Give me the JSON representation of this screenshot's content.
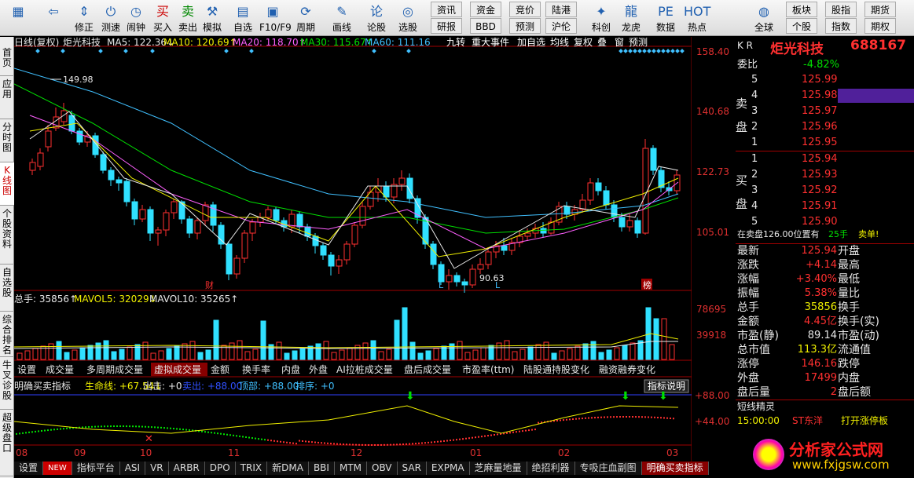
{
  "toolbar": {
    "buttons": [
      {
        "label": "",
        "icon": "grid-icon"
      },
      {
        "label": "",
        "icon": "back-arrow-icon"
      },
      {
        "label": "修正",
        "icon": "up-down-icon"
      },
      {
        "label": "测速",
        "icon": "power-icon"
      },
      {
        "label": "闹钟",
        "icon": "clock-icon"
      },
      {
        "label": "买入",
        "icon": "buy-icon"
      },
      {
        "label": "卖出",
        "icon": "sell-icon"
      },
      {
        "label": "模拟",
        "icon": "hammer-icon"
      },
      {
        "label": "自选",
        "icon": "select-icon"
      },
      {
        "label": "F10/F9",
        "icon": "f10-icon"
      },
      {
        "label": "周期",
        "icon": "period-icon"
      },
      {
        "label": "画线",
        "icon": "pencil-icon"
      },
      {
        "label": "论股",
        "icon": "discuss-icon"
      },
      {
        "label": "选股",
        "icon": "stock-select-icon"
      },
      {
        "label": "科创",
        "icon": "star-icon"
      },
      {
        "label": "龙虎",
        "icon": "dragon-icon"
      },
      {
        "label": "数据",
        "icon": "pe-icon"
      },
      {
        "label": "热点",
        "icon": "hot-icon"
      },
      {
        "label": "全球",
        "icon": "globe-icon"
      }
    ],
    "small": [
      "资讯",
      "资金",
      "竞价",
      "陆港",
      "研报",
      "BBD",
      "预测",
      "沪伦",
      "板块",
      "股指",
      "期货",
      "个股",
      "指数",
      "期权"
    ]
  },
  "left_tabs": [
    "首页",
    "应用",
    "分时图",
    "K线图",
    "个股资料",
    "自选股",
    "综合排名",
    "牛叉诊股",
    "超级盘口"
  ],
  "chart": {
    "header": {
      "period": "日线(复权)",
      "name": "炬光科技",
      "ma5": "MA5: 122.36↓",
      "ma10": "MA10: 120.69↑",
      "ma20": "MA20: 118.70↑",
      "ma30": "MA30: 115.67↑",
      "ma60": "MA60: 111.16"
    },
    "top_tabs": [
      "九转",
      "重大事件",
      "加自选",
      "均线",
      "复权",
      "叠",
      "窗",
      "预测"
    ],
    "price_scale": [
      "158.40",
      "140.68",
      "122.73",
      "105.01"
    ],
    "high_label": "149.98",
    "low_label": "90.63",
    "markers": [
      "财",
      "L",
      "L",
      "榜"
    ],
    "vol_header": {
      "total": "总手: 35856↑",
      "mavol5": "MAVOL5: 32029↓",
      "mavol10": "MAVOL10: 35265↑"
    },
    "vol_scale": [
      "78695",
      "39918"
    ],
    "mid_tabs": [
      "设置",
      "成交量",
      "多周期成交量",
      "虚拟成交量",
      "金额",
      "换手率",
      "内盘",
      "外盘",
      "AI拉桩成交量",
      "盘后成交量",
      "市盈率(ttm)",
      "陆股通持股变化",
      "融资融券变化"
    ],
    "ind_header": {
      "name": "明确买卖指标",
      "life": "生命线: +67.54↓",
      "out": "出击: +0",
      "sell": "卖出: +88.00",
      "top": "顶部: +88.00",
      "order": "排序: +0"
    },
    "ind_btn": "指标说明",
    "ind_scale": [
      "+88.00",
      "+44.00"
    ],
    "x_ticks": [
      "08",
      "09",
      "10",
      "11",
      "12",
      "01",
      "02",
      "03"
    ],
    "bottom_tabs": [
      "设置",
      "NEW",
      "指标平台",
      "ASI",
      "VR",
      "ARBR",
      "DPO",
      "TRIX",
      "新DMA",
      "BBI",
      "MTM",
      "OBV",
      "SAR",
      "EXPMA",
      "芝麻量地量",
      "绝招利器",
      "专吸庄血副图",
      "明确买卖指标"
    ]
  },
  "quote": {
    "market": "K R",
    "name": "炬光科技",
    "code": "688167",
    "weibi_label": "委比",
    "weibi": "-4.82%",
    "sell_label": "卖盘",
    "buy_label": "买盘",
    "sells": [
      {
        "n": "5",
        "p": "125.99",
        "v": ""
      },
      {
        "n": "4",
        "p": "125.98",
        "v": ""
      },
      {
        "n": "3",
        "p": "125.97",
        "v": ""
      },
      {
        "n": "2",
        "p": "125.96",
        "v": ""
      },
      {
        "n": "1",
        "p": "125.95",
        "v": ""
      }
    ],
    "buys": [
      {
        "n": "1",
        "p": "125.94",
        "v": ""
      },
      {
        "n": "2",
        "p": "125.93",
        "v": ""
      },
      {
        "n": "3",
        "p": "125.92",
        "v": ""
      },
      {
        "n": "4",
        "p": "125.91",
        "v": ""
      },
      {
        "n": "5",
        "p": "125.90",
        "v": ""
      }
    ],
    "position_line": "在卖盘126.00位置有",
    "position_hands": "25手",
    "position_tag": "卖单!",
    "stats": [
      {
        "l": "最新",
        "v": "125.94",
        "r": "开盘"
      },
      {
        "l": "涨跌",
        "v": "+4.14",
        "r": "最高"
      },
      {
        "l": "涨幅",
        "v": "+3.40%",
        "r": "最低"
      },
      {
        "l": "振幅",
        "v": "5.38%",
        "r": "量比"
      },
      {
        "l": "总手",
        "v": "35856",
        "r": "换手"
      },
      {
        "l": "金额",
        "v": "4.45亿",
        "r": "换手(实)"
      },
      {
        "l": "市盈(静)",
        "v": "89.14",
        "r": "市盈(动)"
      },
      {
        "l": "总市值",
        "v": "113.3亿",
        "r": "流通值"
      },
      {
        "l": "涨停",
        "v": "146.16",
        "r": "跌停"
      },
      {
        "l": "外盘",
        "v": "17499",
        "r": "内盘"
      },
      {
        "l": "盘后量",
        "v": "2",
        "r": "盘后额"
      }
    ],
    "short_title": "短线精灵",
    "shorts": [
      {
        "t": "15:00:00",
        "s": "ST东洋",
        "e": "打开涨停板"
      }
    ],
    "watermark": "分析家公式网",
    "watermark_url": "www.fxjgsw.com"
  }
}
